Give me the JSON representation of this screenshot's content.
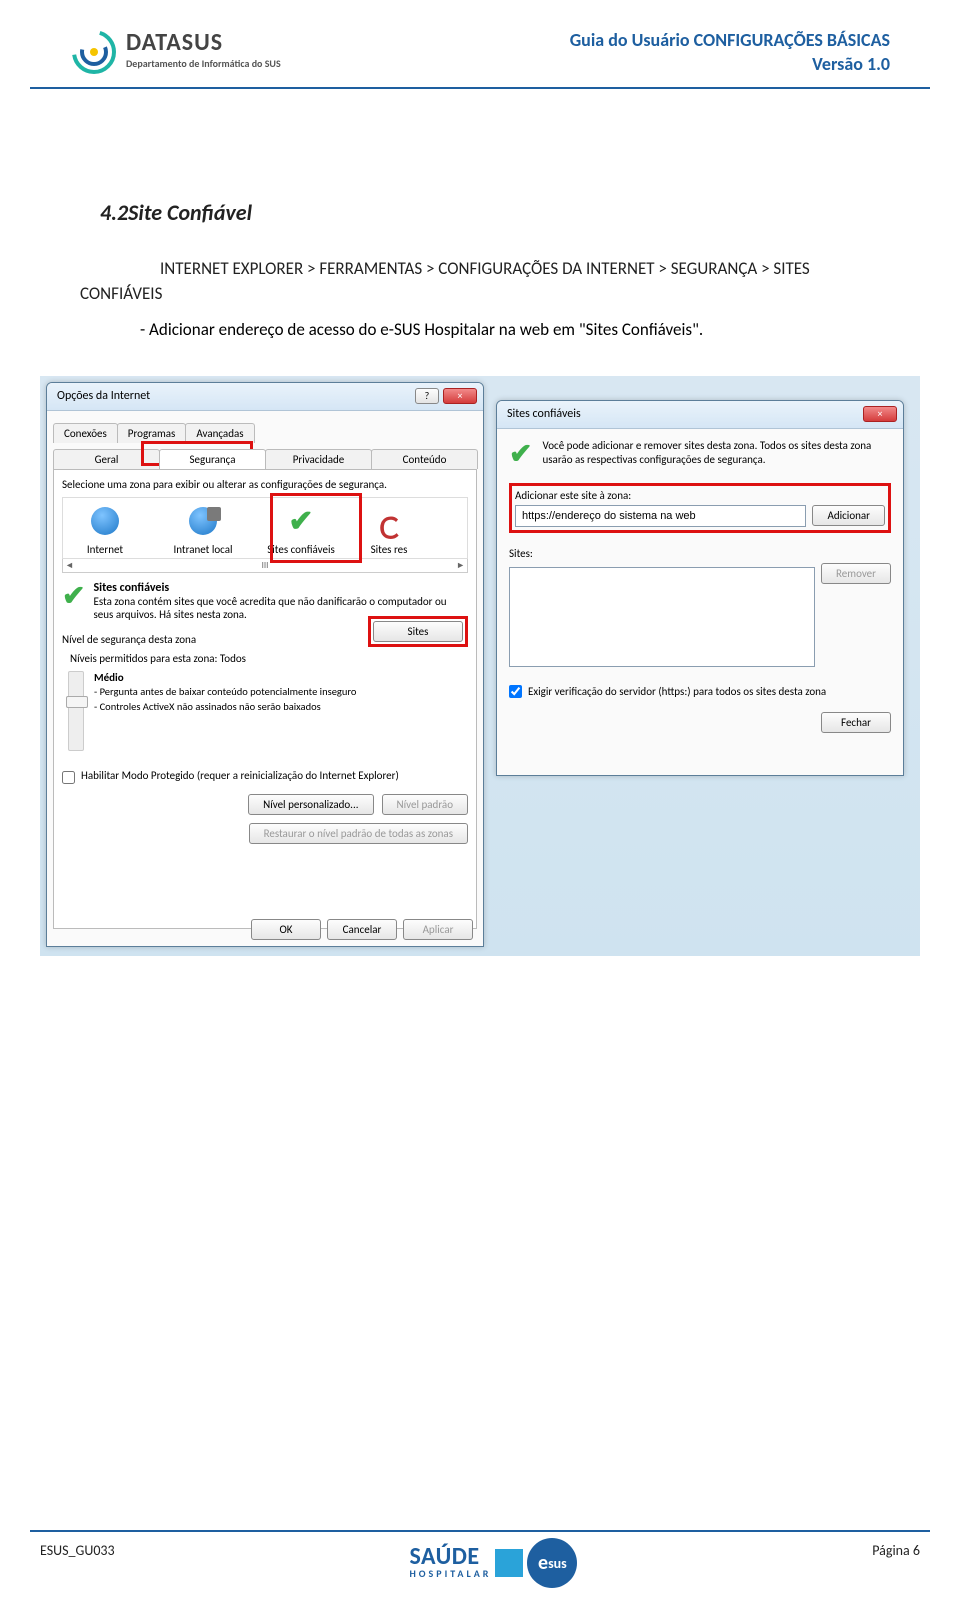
{
  "header": {
    "logo_title": "DATASUS",
    "logo_subtitle": "Departamento de Informática do SUS",
    "doc_title_line1": "Guia do Usuário CONFIGURAÇÕES BÁSICAS",
    "doc_title_line2": "Versão 1.0"
  },
  "section": {
    "heading": "4.2Site Confiável",
    "path_line": "INTERNET EXPLORER > FERRAMENTAS > CONFIGURAÇÕES DA INTERNET > SEGURANÇA > SITES",
    "confiaveis": "CONFIÁVEIS",
    "bullet": "-  Adicionar endereço de acesso do e-SUS Hospitalar na web em \"Sites Confiáveis\"."
  },
  "opts": {
    "title": "Opções da Internet",
    "tabs_row1": [
      "Conexões",
      "Programas",
      "Avançadas"
    ],
    "tabs_row2": [
      "Geral",
      "Segurança",
      "Privacidade",
      "Conteúdo"
    ],
    "zone_instruction": "Selecione uma zona para exibir ou alterar as configurações de segurança.",
    "zones": [
      "Internet",
      "Intranet local",
      "Sites confiáveis",
      "Sites res"
    ],
    "scroll_marker": "III",
    "zone_name": "Sites confiáveis",
    "zone_desc": "Esta zona contém sites que você acredita que não danificarão o computador ou seus arquivos. Há sites nesta zona.",
    "sites_btn": "Sites",
    "level_title": "Nível de segurança desta zona",
    "level_allowed": "Níveis permitidos para esta zona: Todos",
    "level_name": "Médio",
    "level_line1": "- Pergunta antes de baixar conteúdo potencialmente inseguro",
    "level_line2": "- Controles ActiveX não assinados não serão baixados",
    "protected_mode": "Habilitar Modo Protegido (requer a reinicialização do Internet Explorer)",
    "btn_custom": "Nível personalizado...",
    "btn_default": "Nível padrão",
    "btn_restore": "Restaurar o nível padrão de todas as zonas",
    "btn_ok": "OK",
    "btn_cancel": "Cancelar",
    "btn_apply": "Aplicar"
  },
  "trusted": {
    "title": "Sites confiáveis",
    "intro": "Você pode adicionar e remover sites desta zona. Todos os sites desta zona usarão as respectivas configurações de segurança.",
    "add_label": "Adicionar este site à zona:",
    "add_value": "https://endereço do sistema na web",
    "btn_add": "Adicionar",
    "sites_label": "Sites:",
    "btn_remove": "Remover",
    "verify_label": "Exigir verificação do servidor (https:) para todos os sites desta zona",
    "btn_close": "Fechar"
  },
  "footer": {
    "id": "ESUS_GU033",
    "page": "Página 6",
    "saude": "SAÚDE",
    "saude_sub": "HOSPITALAR",
    "esus_e": "e",
    "esus_sus": "sus"
  }
}
